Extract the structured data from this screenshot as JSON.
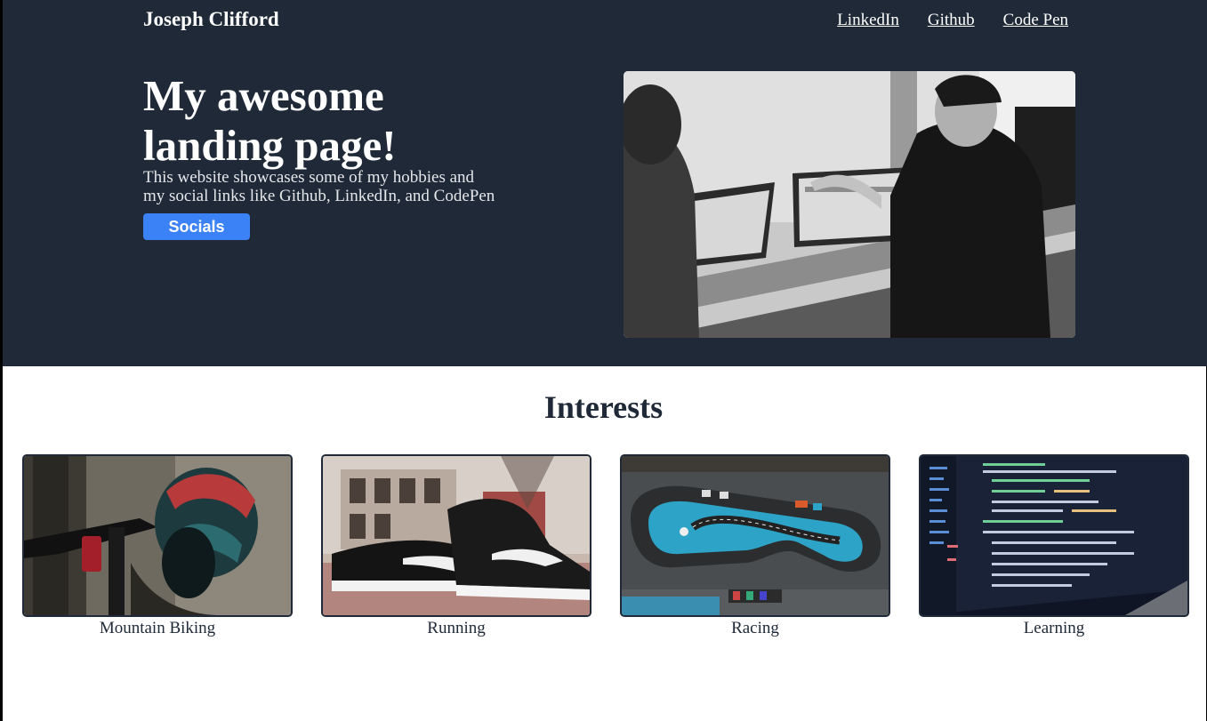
{
  "nav": {
    "brand": "Joseph Clifford",
    "links": [
      "LinkedIn",
      "Github",
      "Code Pen"
    ]
  },
  "hero": {
    "title": "My awesome landing page!",
    "subtitle": "This website showcases some of my hobbies and my social links like Github, LinkedIn, and CodePen",
    "button_label": "Socials",
    "image": "office-meeting-photo"
  },
  "interests": {
    "title": "Interests",
    "cards": [
      {
        "label": "Mountain Biking",
        "image": "mountain-bike-helmet-photo"
      },
      {
        "label": "Running",
        "image": "running-shoes-photo"
      },
      {
        "label": "Racing",
        "image": "race-track-aerial-photo"
      },
      {
        "label": "Learning",
        "image": "code-on-laptop-photo"
      }
    ]
  },
  "colors": {
    "hero_bg": "#1f2937",
    "accent": "#3b82f6",
    "text_dark": "#1f2937",
    "text_light": "#ffffff"
  }
}
